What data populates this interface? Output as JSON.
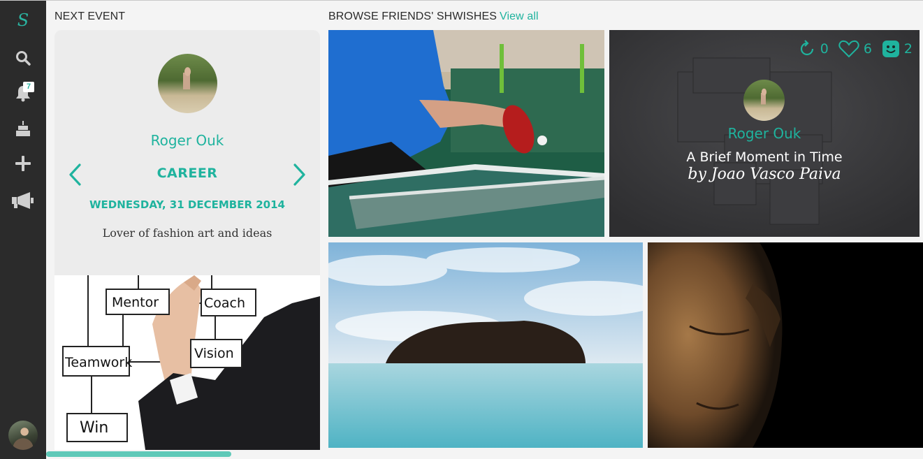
{
  "sidebar": {
    "logo": "S",
    "items": [
      {
        "name": "search",
        "icon": "search-icon"
      },
      {
        "name": "notifications",
        "icon": "bell-icon",
        "badge": "7"
      },
      {
        "name": "events",
        "icon": "cake-icon"
      },
      {
        "name": "add",
        "icon": "plus-icon"
      },
      {
        "name": "announce",
        "icon": "megaphone-icon"
      }
    ],
    "accent": "#2ab3a0",
    "background": "#2b2b2b"
  },
  "next_event": {
    "heading": "NEXT EVENT",
    "name": "Roger Ouk",
    "category": "CAREER",
    "date": "WEDNESDAY, 31 DECEMBER 2014",
    "description": "Lover of fashion art and ideas",
    "prev_icon": "chevron-left-icon",
    "next_icon": "chevron-right-icon"
  },
  "mentor_image": {
    "labels": [
      "Mentor",
      "Coach",
      "Teamwork",
      "Vision",
      "Win"
    ]
  },
  "browse": {
    "heading": "BROWSE FRIENDS' SHWISHES",
    "view_all": "View all",
    "featured": {
      "name": "Roger Ouk",
      "title": "A Brief Moment in Time",
      "author": "by Joao Vasco Paiva",
      "stats": {
        "reshares": "0",
        "likes": "6",
        "smiles": "2"
      }
    }
  },
  "colors": {
    "teal": "#1fb39e",
    "card_bg": "#ececec",
    "page_bg": "#f4f4f4"
  }
}
